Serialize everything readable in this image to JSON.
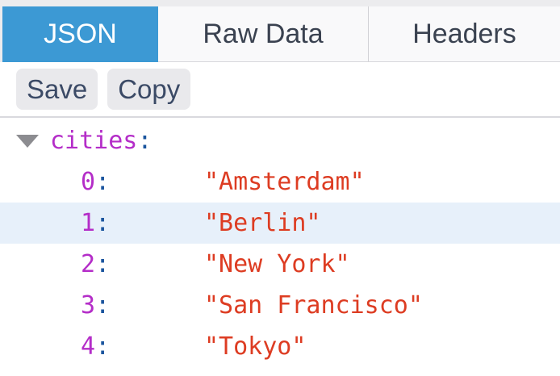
{
  "tabs": {
    "json": {
      "label": "JSON",
      "active": true
    },
    "raw_data": {
      "label": "Raw Data",
      "active": false
    },
    "headers": {
      "label": "Headers",
      "active": false
    }
  },
  "toolbar": {
    "save_label": "Save",
    "copy_label": "Copy"
  },
  "tree": {
    "root": {
      "key": "cities",
      "colon": ":",
      "expanded": true
    },
    "items": [
      {
        "key": "0",
        "colon": ":",
        "value": "\"Amsterdam\"",
        "highlighted": false
      },
      {
        "key": "1",
        "colon": ":",
        "value": "\"Berlin\"",
        "highlighted": true
      },
      {
        "key": "2",
        "colon": ":",
        "value": "\"New York\"",
        "highlighted": false
      },
      {
        "key": "3",
        "colon": ":",
        "value": "\"San Francisco\"",
        "highlighted": false
      },
      {
        "key": "4",
        "colon": ":",
        "value": "\"Tokyo\"",
        "highlighted": false
      }
    ]
  },
  "icons": {
    "expand_arrow": "triangle-down"
  },
  "colors": {
    "active_tab": "#3c99d4",
    "key": "#b42dc8",
    "string": "#dd3c22",
    "colon": "#1b559e",
    "highlight_row": "#e7f0fa",
    "tab_text": "#3a4250",
    "button_text": "#3b4a66"
  }
}
